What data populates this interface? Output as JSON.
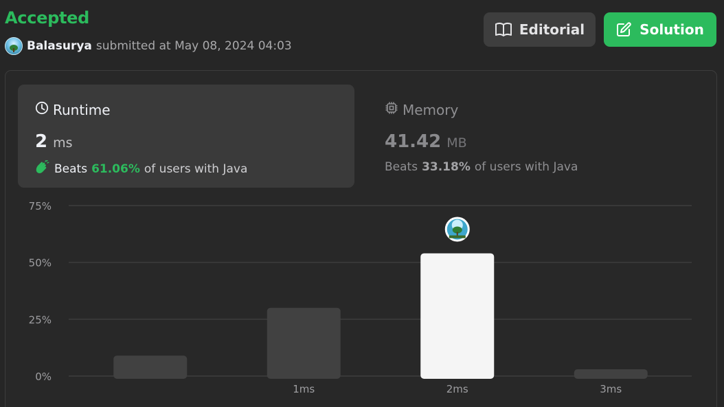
{
  "header": {
    "status": "Accepted",
    "username": "Balasurya",
    "submitted_text": "submitted at May 08, 2024 04:03",
    "editorial_label": "Editorial",
    "solution_label": "Solution"
  },
  "runtime": {
    "title": "Runtime",
    "value": "2",
    "unit": "ms",
    "beats_label": "Beats",
    "beats_pct": "61.06%",
    "beats_rest": "of users with Java"
  },
  "memory": {
    "title": "Memory",
    "value": "41.42",
    "unit": "MB",
    "beats_label": "Beats",
    "beats_pct": "33.18%",
    "beats_rest": "of users with Java"
  },
  "colors": {
    "accent_green": "#2cbb5d",
    "bar_default": "#414141",
    "bar_highlight": "#f5f5f5",
    "gridline": "#3d3d3d"
  },
  "chart_data": {
    "type": "bar",
    "categories": [
      "",
      "1ms",
      "2ms",
      "3ms"
    ],
    "values": [
      9,
      30,
      54,
      3
    ],
    "highlight_index": 2,
    "y_ticks": [
      "0%",
      "25%",
      "50%",
      "75%"
    ],
    "ylim": [
      0,
      75
    ],
    "grid": true
  }
}
